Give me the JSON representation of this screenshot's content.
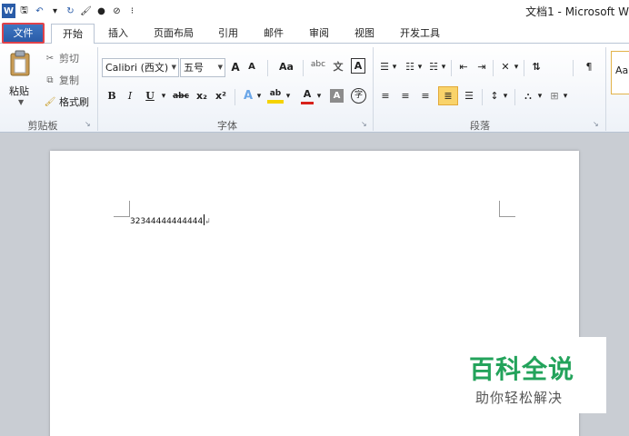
{
  "titlebar": {
    "title": "文档1 - Microsoft W",
    "qat": [
      {
        "icon": "word-app-icon",
        "glyph": "W"
      },
      {
        "icon": "save-icon",
        "glyph": "🖫"
      },
      {
        "icon": "undo-icon",
        "glyph": "↶"
      },
      {
        "icon": "undo-dropdown-icon",
        "glyph": "▾"
      },
      {
        "icon": "redo-icon",
        "glyph": "↻"
      },
      {
        "icon": "format-painter-qat-icon",
        "glyph": "🖌"
      },
      {
        "icon": "color-icon",
        "glyph": "●"
      },
      {
        "icon": "clear-icon",
        "glyph": "⊘"
      },
      {
        "icon": "customize-qat-icon",
        "glyph": "⁝"
      }
    ]
  },
  "tabs": [
    "文件",
    "开始",
    "插入",
    "页面布局",
    "引用",
    "邮件",
    "审阅",
    "视图",
    "开发工具"
  ],
  "clipboard": {
    "paste": "粘贴",
    "cut": "剪切",
    "copy": "复制",
    "format_painter": "格式刷",
    "group_label": "剪贴板"
  },
  "font": {
    "font_name": "Calibri (西文)",
    "font_size": "五号",
    "grow": "A",
    "shrink": "A",
    "change_case": "Aa",
    "clear_format_glyph": "abc",
    "phonetic": "wén",
    "phonetic_char": "文",
    "char_border": "A",
    "bold": "B",
    "italic": "I",
    "underline": "U",
    "strike": "abc",
    "subscript": "x₂",
    "superscript": "x²",
    "text_effect": "A",
    "highlight": "ab",
    "font_color": "A",
    "char_shading": "A",
    "enclose": "字",
    "group_label": "字体"
  },
  "paragraph": {
    "group_label": "段落"
  },
  "styles": {
    "preview": "Aa"
  },
  "document": {
    "text": "32344444444444"
  },
  "watermark": {
    "title": "百科全说",
    "subtitle": "助你轻松解决"
  },
  "colors": {
    "file_tab": "#2a5ca8",
    "file_tab_outline": "#e0424a",
    "highlight": "#f5d300",
    "font_color": "#d8221b",
    "watermark_green": "#23a35b"
  }
}
